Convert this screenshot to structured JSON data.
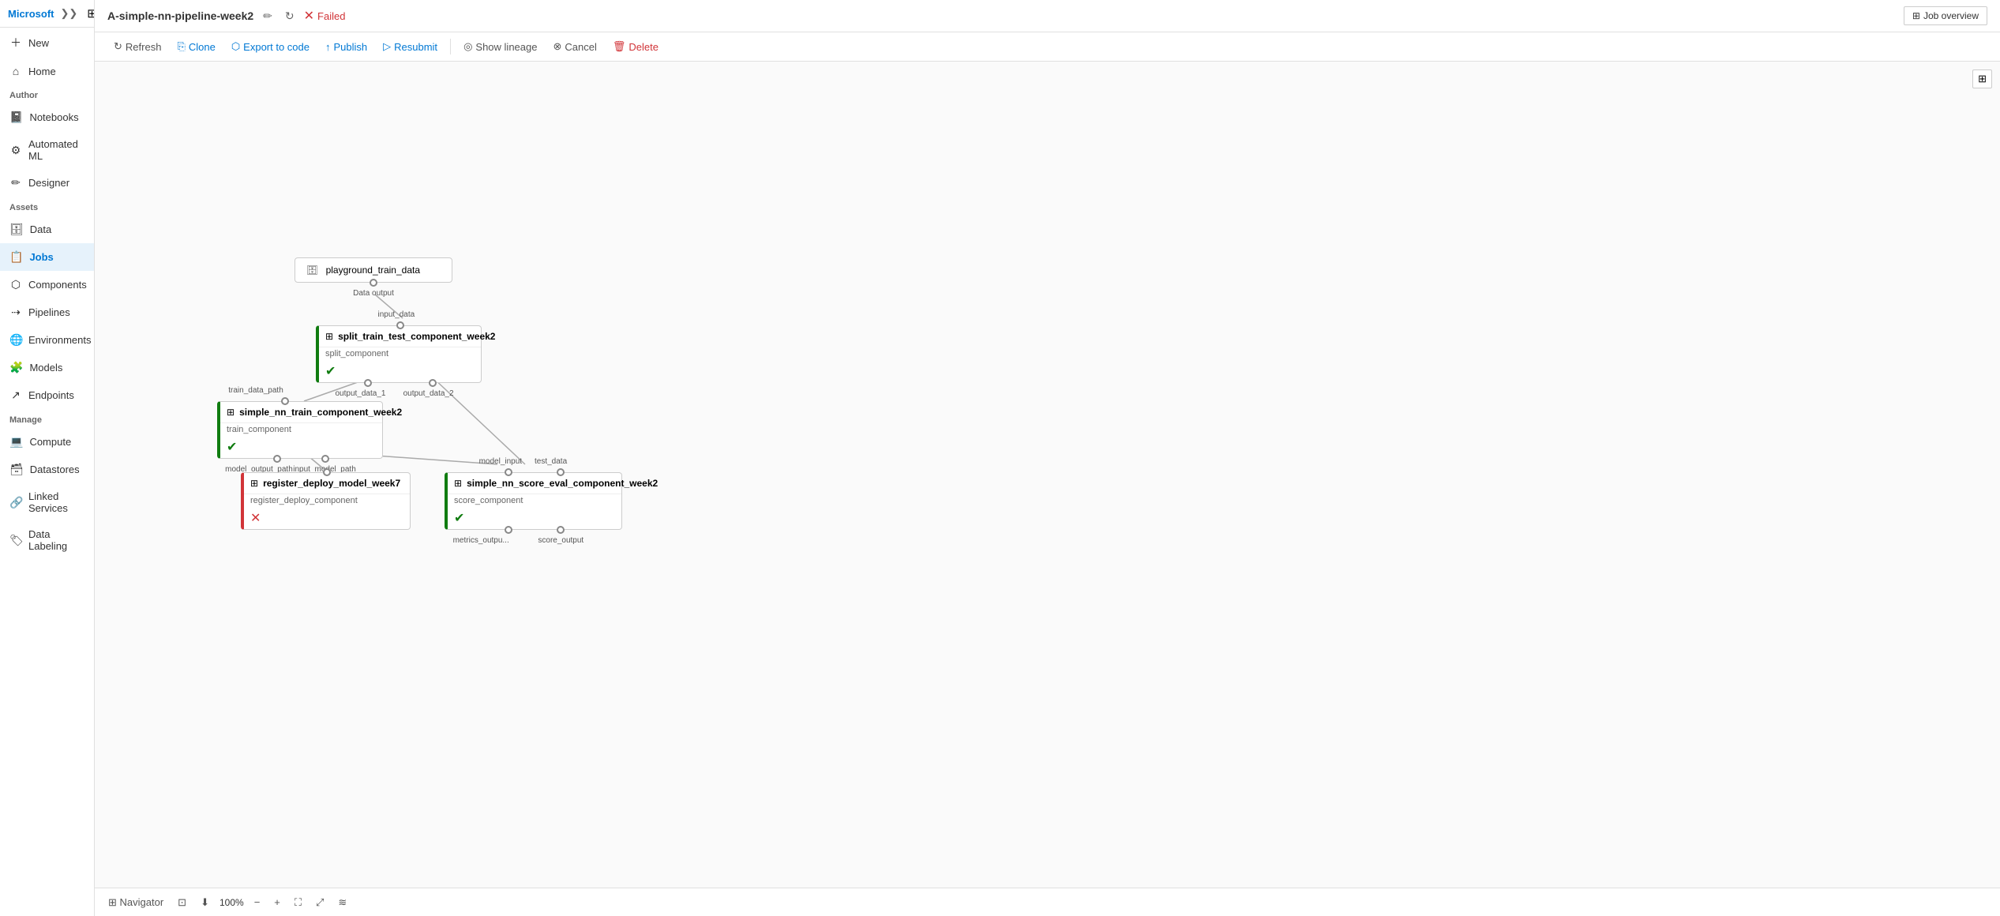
{
  "app": {
    "title": "Microsoft"
  },
  "sidebar": {
    "new_label": "New",
    "home_label": "Home",
    "author_label": "Author",
    "notebooks_label": "Notebooks",
    "automated_ml_label": "Automated ML",
    "designer_label": "Designer",
    "assets_label": "Assets",
    "data_label": "Data",
    "jobs_label": "Jobs",
    "components_label": "Components",
    "pipelines_label": "Pipelines",
    "environments_label": "Environments",
    "models_label": "Models",
    "endpoints_label": "Endpoints",
    "manage_label": "Manage",
    "compute_label": "Compute",
    "datastores_label": "Datastores",
    "linked_services_label": "Linked Services",
    "data_labeling_label": "Data Labeling"
  },
  "topbar": {
    "pipeline_name": "A-simple-nn-pipeline-week2",
    "status": "Failed",
    "job_overview_label": "Job overview"
  },
  "toolbar": {
    "refresh_label": "Refresh",
    "clone_label": "Clone",
    "export_label": "Export to code",
    "publish_label": "Publish",
    "resubmit_label": "Resubmit",
    "show_lineage_label": "Show lineage",
    "cancel_label": "Cancel",
    "delete_label": "Delete"
  },
  "nodes": {
    "data_source": {
      "name": "playground_train_data",
      "port_out_label": "Data output"
    },
    "split": {
      "name": "split_train_test_component_week2",
      "component": "split_component",
      "port_in": "input_data",
      "port_out1": "output_data_1",
      "port_out2": "output_data_2",
      "status": "success"
    },
    "train": {
      "name": "simple_nn_train_component_week2",
      "component": "train_component",
      "port_in": "train_data_path",
      "port_out": "model_output_path",
      "port_out2": "input_model_path",
      "status": "success"
    },
    "register": {
      "name": "register_deploy_model_week7",
      "component": "register_deploy_component",
      "port_in": "input_model_path",
      "status": "failed"
    },
    "score": {
      "name": "simple_nn_score_eval_component_week2",
      "component": "score_component",
      "port_in1": "model_input",
      "port_in2": "test_data",
      "port_out1": "metrics_outpu...",
      "port_out2": "score_output",
      "status": "success"
    }
  },
  "navigator": {
    "label": "Navigator",
    "zoom": "100%"
  }
}
